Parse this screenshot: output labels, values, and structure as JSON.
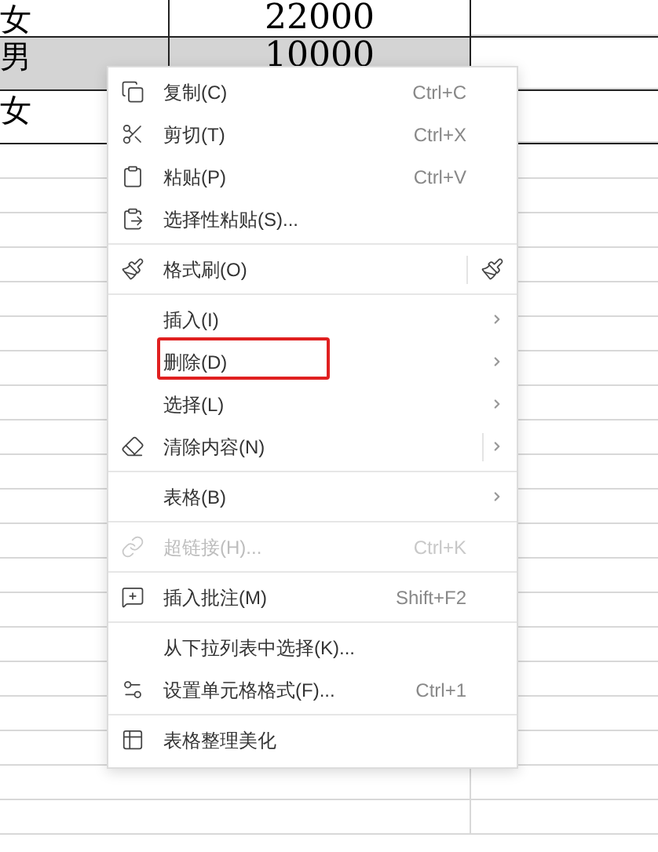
{
  "sheet": {
    "rows": [
      {
        "cells": [
          "女",
          "22000"
        ],
        "selected": false
      },
      {
        "cells": [
          "男",
          "10000"
        ],
        "selected": true
      },
      {
        "cells": [
          "女"
        ],
        "selected": false
      }
    ]
  },
  "context_menu": {
    "groups": [
      [
        {
          "label": "复制(C)",
          "shortcut": "Ctrl+C",
          "submenu": false,
          "disabled": false,
          "annotated": false
        },
        {
          "label": "剪切(T)",
          "shortcut": "Ctrl+X",
          "submenu": false,
          "disabled": false,
          "annotated": false
        },
        {
          "label": "粘贴(P)",
          "shortcut": "Ctrl+V",
          "submenu": false,
          "disabled": false,
          "annotated": false
        },
        {
          "label": "选择性粘贴(S)...",
          "submenu": false,
          "disabled": false,
          "annotated": false
        }
      ],
      [
        {
          "label": "格式刷(O)",
          "submenu": false,
          "disabled": false,
          "annotated": false
        }
      ],
      [
        {
          "label": "插入(I)",
          "submenu": true,
          "disabled": false,
          "annotated": false
        },
        {
          "label": "删除(D)",
          "submenu": true,
          "disabled": false,
          "annotated": true
        },
        {
          "label": "选择(L)",
          "submenu": true,
          "disabled": false,
          "annotated": false
        },
        {
          "label": "清除内容(N)",
          "split": true,
          "submenu": true,
          "disabled": false,
          "annotated": false
        }
      ],
      [
        {
          "label": "表格(B)",
          "submenu": true,
          "disabled": false,
          "annotated": false
        }
      ],
      [
        {
          "label": "超链接(H)...",
          "shortcut": "Ctrl+K",
          "submenu": false,
          "disabled": true,
          "annotated": false
        }
      ],
      [
        {
          "label": "插入批注(M)",
          "shortcut": "Shift+F2",
          "submenu": false,
          "disabled": false,
          "annotated": false
        }
      ],
      [
        {
          "label": "从下拉列表中选择(K)...",
          "submenu": false,
          "disabled": false,
          "annotated": false
        },
        {
          "label": "设置单元格格式(F)...",
          "shortcut": "Ctrl+1",
          "submenu": false,
          "disabled": false,
          "annotated": false
        }
      ],
      [
        {
          "label": "表格整理美化",
          "submenu": false,
          "disabled": false,
          "annotated": false
        }
      ]
    ]
  }
}
